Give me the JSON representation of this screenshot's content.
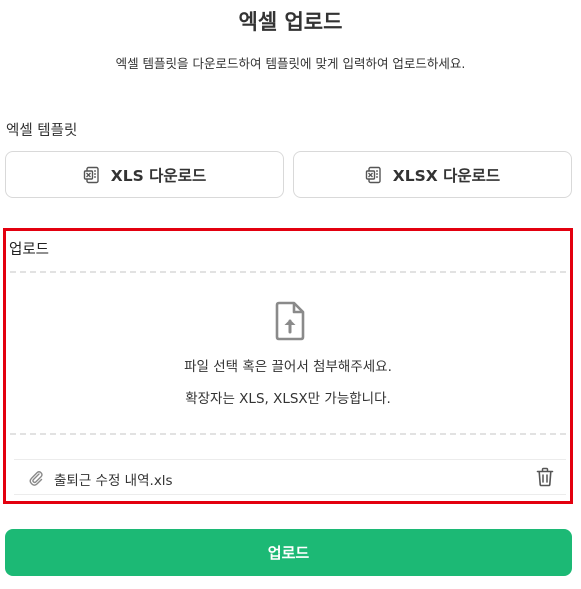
{
  "header": {
    "title": "엑셀 업로드",
    "subtitle": "엑셀 템플릿을 다운로드하여 템플릿에 맞게 입력하여 업로드하세요."
  },
  "template_section": {
    "label": "엑셀 템플릿",
    "xls_button": "XLS 다운로드",
    "xlsx_button": "XLSX 다운로드",
    "icon": "excel-file-icon"
  },
  "upload_section": {
    "label": "업로드",
    "dropzone_text": "파일 선택 혹은 끌어서 첨부해주세요.",
    "dropzone_hint": "확장자는 XLS, XLSX만 가능합니다.",
    "attached_file": "출퇴근 수정 내역.xls"
  },
  "submit_button": "업로드",
  "colors": {
    "accent": "#1cb975",
    "highlight_border": "#e3000f",
    "icon_gray": "#8a8a8a"
  }
}
